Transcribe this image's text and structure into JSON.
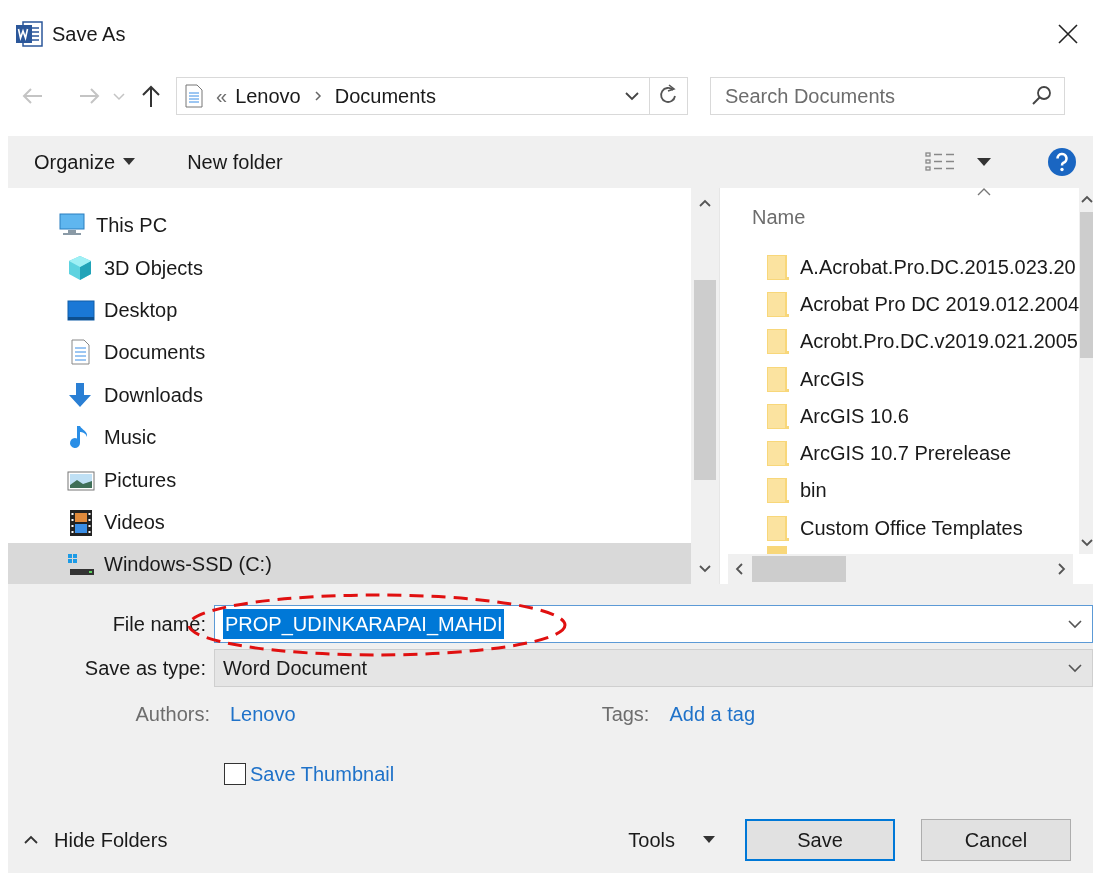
{
  "window": {
    "title": "Save As"
  },
  "address": {
    "overflow": "«",
    "path": [
      "Lenovo",
      "Documents"
    ]
  },
  "search": {
    "placeholder": "Search Documents"
  },
  "toolbar": {
    "organize": "Organize",
    "new_folder": "New folder"
  },
  "tree": [
    {
      "label": "This PC",
      "kind": "computer",
      "selected": false,
      "children": [
        {
          "label": "3D Objects",
          "kind": "cube",
          "selected": false
        },
        {
          "label": "Desktop",
          "kind": "desktop",
          "selected": false
        },
        {
          "label": "Documents",
          "kind": "document",
          "selected": false
        },
        {
          "label": "Downloads",
          "kind": "download",
          "selected": false
        },
        {
          "label": "Music",
          "kind": "music",
          "selected": false
        },
        {
          "label": "Pictures",
          "kind": "picture",
          "selected": false
        },
        {
          "label": "Videos",
          "kind": "video",
          "selected": false
        },
        {
          "label": "Windows-SSD (C:)",
          "kind": "drive",
          "selected": true
        }
      ]
    }
  ],
  "file_list": {
    "column": "Name",
    "items": [
      {
        "name": "A.Acrobat.Pro.DC.2015.023.20"
      },
      {
        "name": "Acrobat Pro DC 2019.012.2004"
      },
      {
        "name": "Acrobt.Pro.DC.v2019.021.2005"
      },
      {
        "name": "ArcGIS"
      },
      {
        "name": "ArcGIS 10.6"
      },
      {
        "name": "ArcGIS 10.7 Prerelease"
      },
      {
        "name": "bin"
      },
      {
        "name": "Custom Office Templates"
      }
    ]
  },
  "form": {
    "file_name": {
      "label": "File name:",
      "value": "PROP_UDINKARAPAI_MAHDI",
      "highlighted": true
    },
    "save_as_type": {
      "label": "Save as type:",
      "value": "Word Document"
    },
    "authors": {
      "label": "Authors:",
      "value": "Lenovo"
    },
    "tags": {
      "label": "Tags:",
      "value": "Add a tag"
    },
    "save_thumbnail": {
      "label": "Save Thumbnail",
      "checked": false
    }
  },
  "footer": {
    "hide_folders": "Hide Folders",
    "tools": "Tools",
    "buttons": [
      {
        "label": "Save",
        "default": true
      },
      {
        "label": "Cancel",
        "default": false
      }
    ]
  }
}
